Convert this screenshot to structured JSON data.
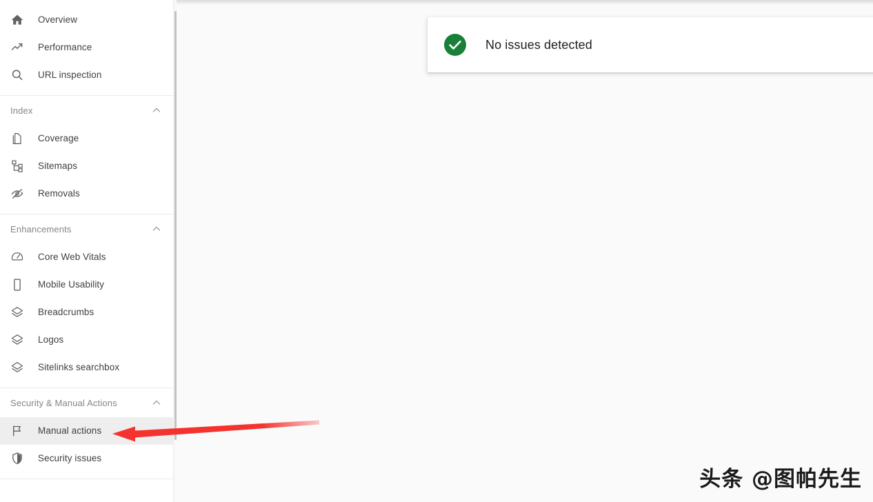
{
  "sidebar": {
    "top_items": [
      {
        "label": "Overview",
        "icon": "home-icon",
        "selected": false
      },
      {
        "label": "Performance",
        "icon": "trending-up-icon",
        "selected": false
      },
      {
        "label": "URL inspection",
        "icon": "search-icon",
        "selected": false
      }
    ],
    "sections": [
      {
        "title": "Index",
        "chevron": "chevron-up-icon",
        "items": [
          {
            "label": "Coverage",
            "icon": "pages-icon",
            "selected": false
          },
          {
            "label": "Sitemaps",
            "icon": "account-tree-icon",
            "selected": false
          },
          {
            "label": "Removals",
            "icon": "eye-off-icon",
            "selected": false
          }
        ]
      },
      {
        "title": "Enhancements",
        "chevron": "chevron-up-icon",
        "items": [
          {
            "label": "Core Web Vitals",
            "icon": "speedometer-icon",
            "selected": false
          },
          {
            "label": "Mobile Usability",
            "icon": "phone-icon",
            "selected": false
          },
          {
            "label": "Breadcrumbs",
            "icon": "layers-icon",
            "selected": false
          },
          {
            "label": "Logos",
            "icon": "layers-icon",
            "selected": false
          },
          {
            "label": "Sitelinks searchbox",
            "icon": "layers-icon",
            "selected": false
          }
        ]
      },
      {
        "title": "Security & Manual Actions",
        "chevron": "chevron-up-icon",
        "items": [
          {
            "label": "Manual actions",
            "icon": "flag-icon",
            "selected": true
          },
          {
            "label": "Security issues",
            "icon": "shield-icon",
            "selected": false
          }
        ]
      }
    ],
    "scrollbar": {
      "up_arrow_icon": "scroll-up-arrow-icon",
      "thumb_color": "#c1c1c1",
      "track_color": "#f8f8f8"
    }
  },
  "content": {
    "status_card": {
      "icon": "check-circle-icon",
      "icon_color": "#188038",
      "message": "No issues detected"
    }
  },
  "annotation": {
    "arrow_color": "#f4322e",
    "direction": "left"
  },
  "watermark": {
    "text": "头条 @图帕先生"
  }
}
